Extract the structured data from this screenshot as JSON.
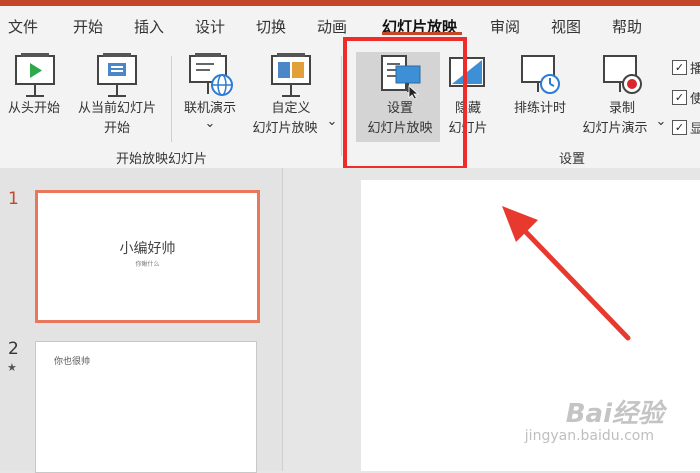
{
  "tabs": [
    {
      "label": "文件",
      "active": false
    },
    {
      "label": "开始",
      "active": false
    },
    {
      "label": "插入",
      "active": false
    },
    {
      "label": "设计",
      "active": false
    },
    {
      "label": "切换",
      "active": false
    },
    {
      "label": "动画",
      "active": false
    },
    {
      "label": "幻灯片放映",
      "active": true
    },
    {
      "label": "审阅",
      "active": false
    },
    {
      "label": "视图",
      "active": false
    },
    {
      "label": "帮助",
      "active": false
    }
  ],
  "ribbon": {
    "group_start": {
      "label": "开始放映幻灯片",
      "from_beginning": "从头开始",
      "from_current_line1": "从当前幻灯片",
      "from_current_line2": "开始",
      "online_present": "联机演示",
      "custom_line1": "自定义",
      "custom_line2": "幻灯片放映"
    },
    "group_setup": {
      "label": "设置",
      "setup_line1": "设置",
      "setup_line2": "幻灯片放映",
      "hide_line1": "隐藏",
      "hide_line2": "幻灯片",
      "rehearse": "排练计时",
      "record_line1": "录制",
      "record_line2": "幻灯片演示"
    },
    "checkboxes": [
      {
        "label": "播",
        "checked": true
      },
      {
        "label": "使",
        "checked": true
      },
      {
        "label": "显",
        "checked": true
      }
    ]
  },
  "slides": [
    {
      "number": "1",
      "title": "小编好帅",
      "subtitle": "你瞅什么",
      "selected": true
    },
    {
      "number": "2",
      "star": "★",
      "text": "你也很帅",
      "selected": false
    }
  ],
  "watermark": {
    "brand": "Bai经验",
    "url": "jingyan.baidu.com"
  },
  "colors": {
    "accent": "#c4472a",
    "highlight_box": "#ee2c2c",
    "annotation_arrow": "#e8392f"
  }
}
